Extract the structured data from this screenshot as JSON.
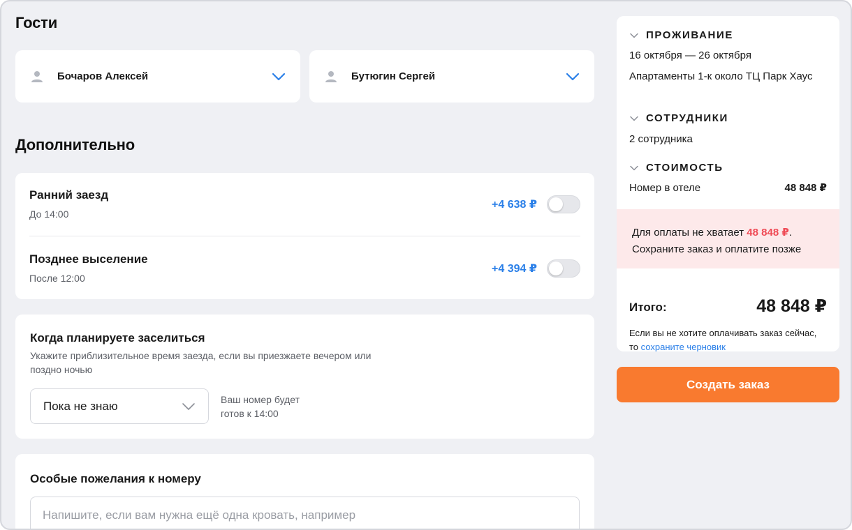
{
  "guests": {
    "title": "Гости",
    "items": [
      {
        "name": "Бочаров Алексей"
      },
      {
        "name": "Бутюгин Сергей"
      }
    ]
  },
  "extras": {
    "title": "Дополнительно",
    "options": [
      {
        "title": "Ранний заезд",
        "sub": "До 14:00",
        "price": "+4 638 ₽",
        "enabled": false
      },
      {
        "title": "Позднее выселение",
        "sub": "После 12:00",
        "price": "+4 394 ₽",
        "enabled": false
      }
    ]
  },
  "checkin": {
    "title": "Когда планируете заселиться",
    "description": "Укажите приблизительное время заезда, если вы приезжаете вечером или поздно ночью",
    "selected": "Пока не знаю",
    "hint": "Ваш номер будет готов к 14:00"
  },
  "wishes": {
    "title": "Особые пожелания к номеру",
    "placeholder": "Напишите, если вам нужна ещё одна кровать, например"
  },
  "summary": {
    "stay": {
      "label": "ПРОЖИВАНИЕ",
      "dates": "16 октября — 26 октября",
      "hotel": "Апартаменты 1-к около ТЦ Парк Хаус"
    },
    "staff": {
      "label": "СОТРУДНИКИ",
      "count": "2 сотрудника"
    },
    "cost": {
      "label": "СТОИМОСТЬ",
      "item_label": "Номер в отеле",
      "item_value": "48 848 ₽"
    },
    "warning": {
      "before": "Для оплаты не хватает ",
      "amount": "48 848 ₽",
      "after": ".",
      "line2": "Сохраните заказ и оплатите позже"
    },
    "total_label": "Итого:",
    "total_value": "48 848 ₽",
    "note_text": "Если вы не хотите оплачивать заказ сейчас, то ",
    "note_link": "сохраните черновик"
  },
  "cta": {
    "label": "Создать заказ"
  },
  "colors": {
    "accent": "#2a7fe8",
    "cta": "#f97a2f",
    "warning_bg": "#fde9ea",
    "warning_text": "#ef4a55"
  }
}
